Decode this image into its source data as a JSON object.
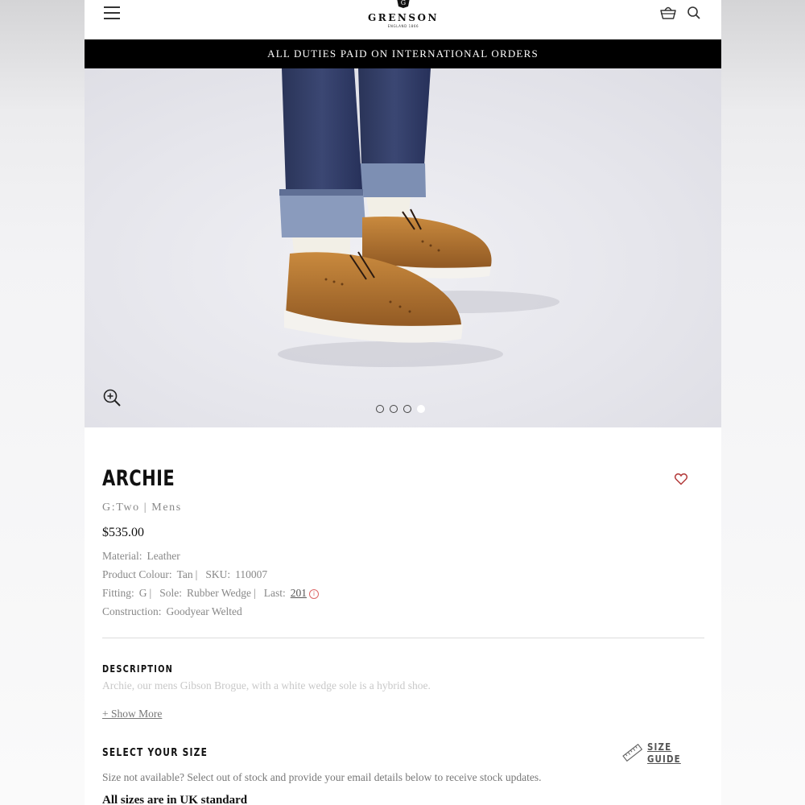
{
  "header": {
    "brand": "GRENSON",
    "brand_sub": "ENGLAND 1866",
    "crest_letter": "G",
    "icons": [
      "hamburger-menu-icon",
      "basket-icon",
      "search-icon"
    ]
  },
  "banner": {
    "text": "ALL DUTIES PAID ON INTERNATIONAL ORDERS"
  },
  "gallery": {
    "slide_count": 4,
    "active_slide": 4,
    "zoom_icon": "zoom-in-icon"
  },
  "product": {
    "name": "ARCHIE",
    "category": "G:Two | Mens",
    "price": "$535.00",
    "material_label": "Material:",
    "material": "Leather",
    "colour_label": "Product Colour:",
    "colour": "Tan",
    "sku_label": "SKU:",
    "sku": "110007",
    "fitting_label": "Fitting:",
    "fitting": "G",
    "sole_label": "Sole:",
    "sole": "Rubber Wedge",
    "last_label": "Last:",
    "last": "201",
    "last_info_icon": "i",
    "construction_label": "Construction:",
    "construction": "Goodyear Welted",
    "separator": "|"
  },
  "description": {
    "heading": "DESCRIPTION",
    "text": "Archie, our mens Gibson Brogue, with a white wedge sole is a hybrid shoe.",
    "show_more": "+ Show More"
  },
  "size": {
    "heading": "SELECT YOUR SIZE",
    "guide_label": "SIZE GUIDE",
    "note": "Size not available? Select out of stock and provide your email details below to receive stock updates.",
    "standard": "All sizes are in UK standard"
  },
  "colors": {
    "banner_bg": "#000000",
    "heart": "#b33a3a",
    "muted_text": "#888888"
  }
}
